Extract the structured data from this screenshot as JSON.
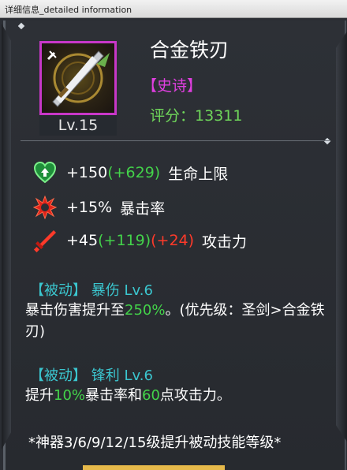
{
  "window": {
    "title": "详细信息_detailed information"
  },
  "item": {
    "name": "合金铁刃",
    "rarity": "【史诗】",
    "score_label": "评分：",
    "score_value": "13311",
    "level": "Lv.15",
    "icon": "alloy-blade-icon"
  },
  "stats": [
    {
      "icon": "heart-up-icon",
      "base": "+150",
      "bonus": "(+629)",
      "extra": "",
      "label": "生命上限"
    },
    {
      "icon": "crit-burst-icon",
      "base": "+15%",
      "bonus": "",
      "extra": "",
      "label": "暴击率"
    },
    {
      "icon": "sword-icon",
      "base": "+45",
      "bonus": "(+119)",
      "extra": "(+24)",
      "label": "攻击力"
    }
  ],
  "skills": [
    {
      "tag": "【被动】",
      "name": "暴伤 Lv.6",
      "desc_pre": "暴击伤害提升至",
      "desc_hl": "250%",
      "desc_post": "。(优先级：圣剑>合金铁刃)"
    },
    {
      "tag": "【被动】",
      "name": "锋利 Lv.6",
      "desc_pre": "提升",
      "desc_hl1": "10%",
      "desc_mid": "暴击率和",
      "desc_hl2": "60",
      "desc_post": "点攻击力。"
    }
  ],
  "footnote": "*神器3/6/9/12/15级提升被动技能等级*",
  "colors": {
    "rarity_epic": "#e03fe0",
    "green_bonus": "#43d34a",
    "red_bonus": "#ff3a2a",
    "skill_cyan": "#3bc6cf",
    "frame_magenta": "#c837c8"
  }
}
